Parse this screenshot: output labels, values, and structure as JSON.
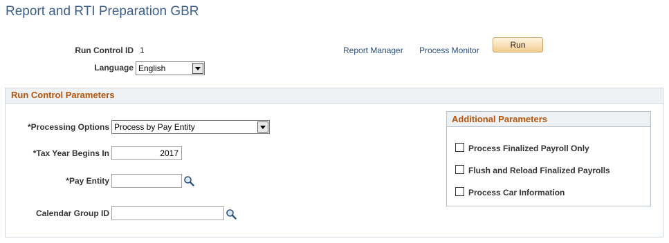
{
  "page": {
    "title": "Report and RTI Preparation GBR"
  },
  "header": {
    "run_control_label": "Run Control ID",
    "run_control_value": "1",
    "language_label": "Language",
    "language_value": "English",
    "report_manager_link": "Report Manager",
    "process_monitor_link": "Process Monitor",
    "run_button": "Run"
  },
  "section": {
    "title": "Run Control Parameters",
    "processing_options_label": "*Processing Options",
    "processing_options_value": "Process by Pay Entity",
    "tax_year_label": "*Tax Year Begins In",
    "tax_year_value": "2017",
    "pay_entity_label": "*Pay Entity",
    "pay_entity_value": "",
    "calendar_group_label": "Calendar Group ID",
    "calendar_group_value": ""
  },
  "additional": {
    "title": "Additional Parameters",
    "checkboxes": [
      {
        "label": "Process Finalized Payroll Only",
        "checked": false
      },
      {
        "label": "Flush and Reload Finalized Payrolls",
        "checked": false
      },
      {
        "label": "Process Car Information",
        "checked": false
      }
    ]
  },
  "colors": {
    "title": "#3b5e8c",
    "section_title": "#b5540a",
    "link": "#2a4e80",
    "run_button": "#f4cc90"
  },
  "icons": {
    "lookup": "magnifier-icon",
    "dropdown": "chevron-down-icon"
  }
}
